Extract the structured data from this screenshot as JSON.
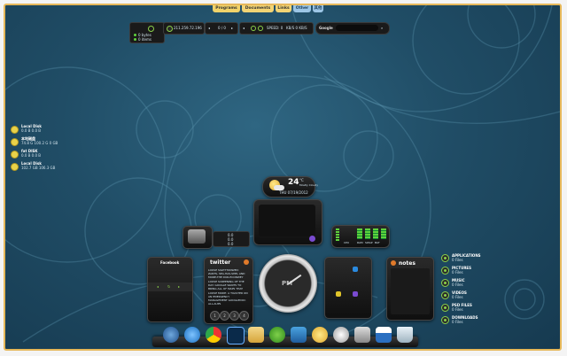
{
  "tabs": [
    "Programs",
    "Documents",
    "Links",
    "Other",
    "其他"
  ],
  "topbar": {
    "status_lines": [
      "0 bytes",
      "0 items"
    ],
    "ip": "211.259.72.196",
    "media_value": "0 / 0",
    "speed_label": "SPEED: 0",
    "speed_val": "KB/S  0 KB/S",
    "search_logo": "Google",
    "search_placeholder": ""
  },
  "drives": [
    {
      "name": "Local Disk",
      "info": "0.0 B   0.0 B"
    },
    {
      "name": "本地磁盘",
      "info": "74.8 G 100.2 G 0 GB"
    },
    {
      "name": "fat DISK",
      "info": "0.0 B   0.0 B"
    },
    {
      "name": "Local Disk",
      "info": "102.7 GB  106.3 GB"
    }
  ],
  "weather": {
    "temp": "24",
    "unit": "°C",
    "location": "Mostly Cloudy",
    "date": "THU 07/19/2012"
  },
  "small_gadget_lines": [
    "0.0",
    "0.0",
    "0.0"
  ],
  "meters": {
    "labels": [
      "CPU",
      "RAM",
      "SWAP",
      "BAT"
    ]
  },
  "facebook": {
    "title": "Facebook"
  },
  "twitter": {
    "logo": "twitter",
    "tweets": [
      "LOOSE SIGHTTONWED: ZANTS, SEA-HAS-SHEL AND MORE-THE DUR-ECONWEY",
      "LOOSE SCREENING OF THE DAY: GOOGLE WANTS TO BRING ALL OF MAPS THAT",
      "LOOSE MODE: A TOASTER ON AN EMERGENCY MANAGEMENT GOOGLEDOC ALL-AUPS"
    ],
    "pages": [
      "1",
      "2",
      "3",
      "4"
    ]
  },
  "clock": {
    "ampm": "PM"
  },
  "notes": {
    "title": "notes"
  },
  "libraries": [
    {
      "name": "APPLICATIONS",
      "count": "0 Files"
    },
    {
      "name": "PICTURES",
      "count": "0 Files"
    },
    {
      "name": "MUSIC",
      "count": "0 Files"
    },
    {
      "name": "VIDEOS",
      "count": "0 Files"
    },
    {
      "name": "PSD FILES",
      "count": "0 Files"
    },
    {
      "name": "DOWNLOADS",
      "count": "0 Files"
    }
  ],
  "dock": [
    "start-orb",
    "internet-explorer",
    "chrome",
    "photoshop",
    "folder",
    "utorrent",
    "virtualbox",
    "sun-app",
    "clock-app",
    "network",
    "calendar",
    "recycle-bin"
  ],
  "colors": {
    "accent": "#e6b85a",
    "green": "#8bd14a",
    "background": "#1f4b64"
  }
}
